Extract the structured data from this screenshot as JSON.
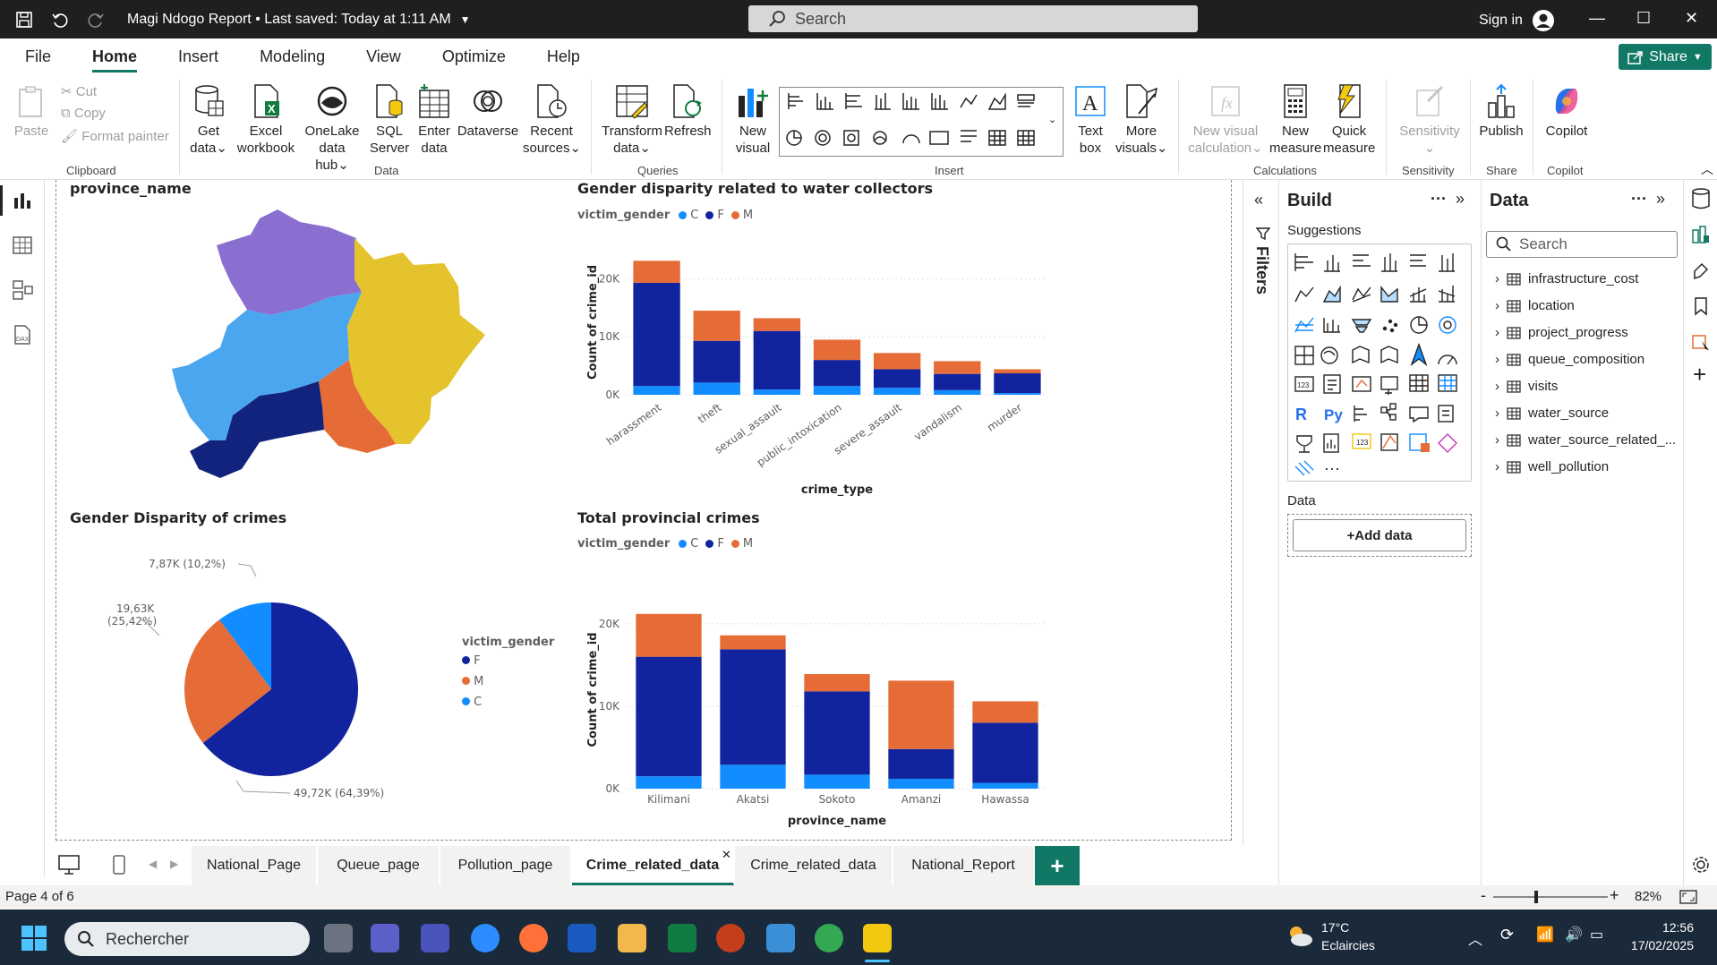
{
  "titlebar": {
    "title": "Magi Ndogo Report • Last saved: Today at 1:11 AM",
    "search_placeholder": "Search",
    "sign_in": "Sign in"
  },
  "menu": {
    "items": [
      "File",
      "Home",
      "Insert",
      "Modeling",
      "View",
      "Optimize",
      "Help"
    ],
    "active": "Home",
    "share": "Share"
  },
  "ribbon": {
    "clipboard": {
      "paste": "Paste",
      "cut": "Cut",
      "copy": "Copy",
      "format_painter": "Format painter",
      "label": "Clipboard"
    },
    "data": {
      "get_data": [
        "Get",
        "data"
      ],
      "excel": [
        "Excel",
        "workbook"
      ],
      "onelake": [
        "OneLake",
        "data hub"
      ],
      "sql": [
        "SQL",
        "Server"
      ],
      "enter": [
        "Enter",
        "data"
      ],
      "dataverse": "Dataverse",
      "recent": [
        "Recent",
        "sources"
      ],
      "label": "Data"
    },
    "queries": {
      "transform": [
        "Transform",
        "data"
      ],
      "refresh": "Refresh",
      "label": "Queries"
    },
    "insert": {
      "new_visual": [
        "New",
        "visual"
      ],
      "text_box": [
        "Text",
        "box"
      ],
      "more_visuals": [
        "More",
        "visuals"
      ],
      "label": "Insert"
    },
    "calculations": {
      "new_visual_calc": [
        "New visual",
        "calculation"
      ],
      "new_measure": [
        "New",
        "measure"
      ],
      "quick_measure": [
        "Quick",
        "measure"
      ],
      "label": "Calculations"
    },
    "sensitivity": {
      "btn": "Sensitivity",
      "label": "Sensitivity"
    },
    "share": {
      "publish": "Publish",
      "label": "Share"
    },
    "copilot": {
      "btn": "Copilot",
      "label": "Copilot"
    }
  },
  "visuals": {
    "map": {
      "title": "province_name"
    },
    "stacked1": {
      "title": "Gender disparity related to water collectors",
      "legend_title": "victim_gender",
      "legend": [
        "C",
        "F",
        "M"
      ]
    },
    "pie": {
      "title": "Gender Disparity of crimes",
      "legend_title": "victim_gender",
      "legend": [
        "F",
        "M",
        "C"
      ],
      "label_f": "49,72K (64,39%)",
      "label_m1": "19,63K",
      "label_m2": "(25,42%)",
      "label_c": "7,87K (10,2%)"
    },
    "stacked2": {
      "title": "Total provincial crimes",
      "legend_title": "victim_gender",
      "legend": [
        "C",
        "F",
        "M"
      ]
    }
  },
  "chart_data": [
    {
      "type": "bar",
      "stacked": true,
      "title": "Gender disparity related to water collectors",
      "xlabel": "crime_type",
      "ylabel": "Count of crime_id",
      "categories": [
        "harassment",
        "theft",
        "sexual_assault",
        "public_intoxication",
        "severe_assault",
        "vandalism",
        "murder"
      ],
      "series": [
        {
          "name": "C",
          "values": [
            1500,
            2100,
            900,
            1500,
            1200,
            800,
            300
          ]
        },
        {
          "name": "F",
          "values": [
            17800,
            7200,
            10100,
            4500,
            3200,
            2800,
            3400
          ]
        },
        {
          "name": "M",
          "values": [
            3800,
            5200,
            2200,
            3500,
            2800,
            2200,
            700
          ]
        }
      ],
      "yticks": [
        "0K",
        "10K",
        "20K"
      ],
      "ylim": [
        0,
        25000
      ],
      "grid": true,
      "legend_position": "top-left"
    },
    {
      "type": "pie",
      "title": "Gender Disparity of crimes",
      "categories": [
        "F",
        "M",
        "C"
      ],
      "values": [
        49720,
        19630,
        7870
      ],
      "percent": [
        64.39,
        25.42,
        10.2
      ]
    },
    {
      "type": "bar",
      "stacked": true,
      "title": "Total provincial crimes",
      "xlabel": "province_name",
      "ylabel": "Count of crime_id",
      "categories": [
        "Kilimani",
        "Akatsi",
        "Sokoto",
        "Amanzi",
        "Hawassa"
      ],
      "series": [
        {
          "name": "C",
          "values": [
            1500,
            2900,
            1700,
            1200,
            700
          ]
        },
        {
          "name": "F",
          "values": [
            14500,
            14000,
            10100,
            3600,
            7300
          ]
        },
        {
          "name": "M",
          "values": [
            5200,
            1700,
            2100,
            8300,
            2600
          ]
        }
      ],
      "yticks": [
        "0K",
        "10K",
        "20K"
      ],
      "ylim": [
        0,
        24000
      ],
      "grid": true,
      "legend_position": "top-left"
    }
  ],
  "colors": {
    "C": "#118dff",
    "F": "#12239e",
    "M": "#e66c37",
    "accent": "#117865"
  },
  "build_pane": {
    "title": "Build",
    "suggestions": "Suggestions",
    "data_label": "Data",
    "add_data": "+Add data"
  },
  "filters_label": "Filters",
  "data_pane": {
    "title": "Data",
    "search_placeholder": "Search",
    "tables": [
      "infrastructure_cost",
      "location",
      "project_progress",
      "queue_composition",
      "visits",
      "water_source",
      "water_source_related_...",
      "well_pollution"
    ]
  },
  "tabs": [
    "National_Page",
    "Queue_page",
    "Pollution_page",
    "Crime_related_data",
    "Crime_related_data",
    "National_Report"
  ],
  "active_tab": 3,
  "status": {
    "page": "Page 4 of 6",
    "zoom": "82%"
  },
  "taskbar": {
    "search": "Rechercher",
    "weather_temp": "17°C",
    "weather_desc": "Eclaircies",
    "time": "12:56",
    "date": "17/02/2025"
  }
}
